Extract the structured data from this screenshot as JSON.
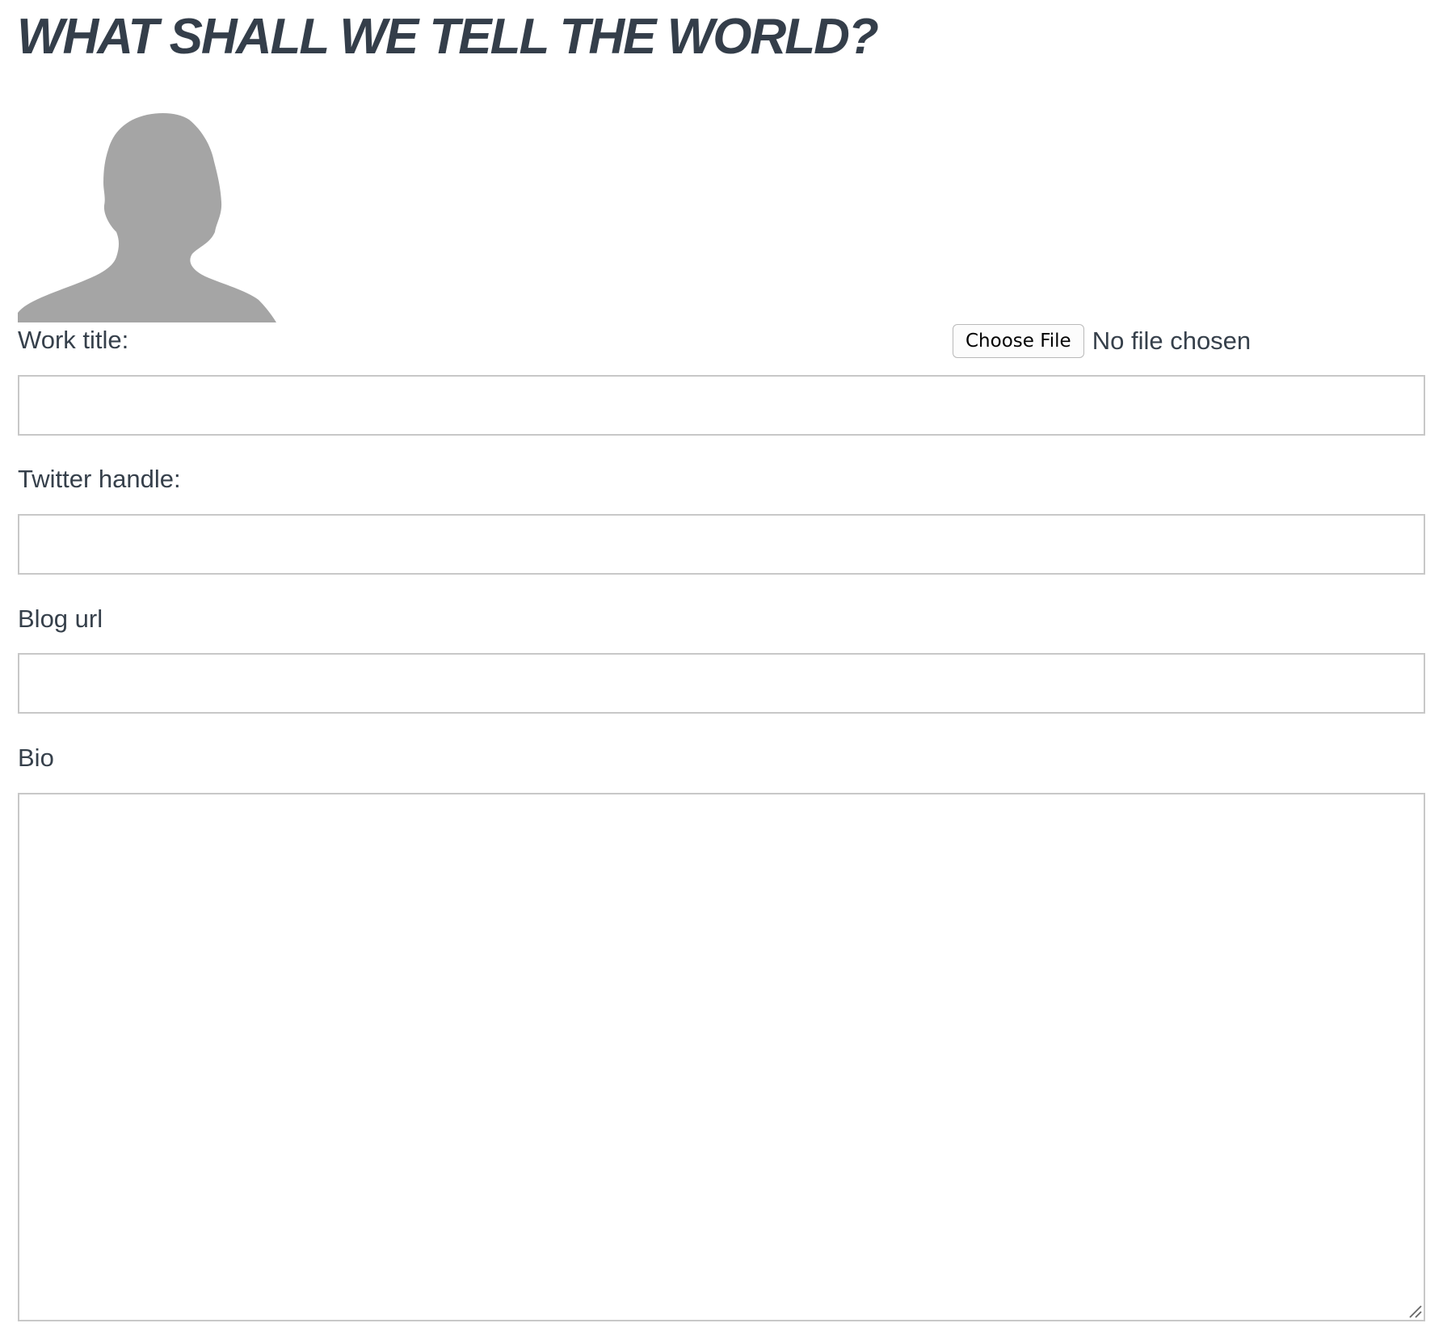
{
  "page": {
    "title": "WHAT SHALL WE TELL THE WORLD?"
  },
  "avatar": {
    "icon": "person-silhouette-icon",
    "color": "#a5a5a5"
  },
  "file_upload": {
    "button_label": "Choose File",
    "status": "No file chosen"
  },
  "form": {
    "work_title": {
      "label": "Work title:",
      "value": ""
    },
    "twitter_handle": {
      "label": "Twitter handle:",
      "value": ""
    },
    "blog_url": {
      "label": "Blog url",
      "value": ""
    },
    "bio": {
      "label": "Bio",
      "value": ""
    }
  },
  "colors": {
    "text": "#36404b",
    "input_border": "#c8c8c8",
    "background": "#ffffff"
  }
}
